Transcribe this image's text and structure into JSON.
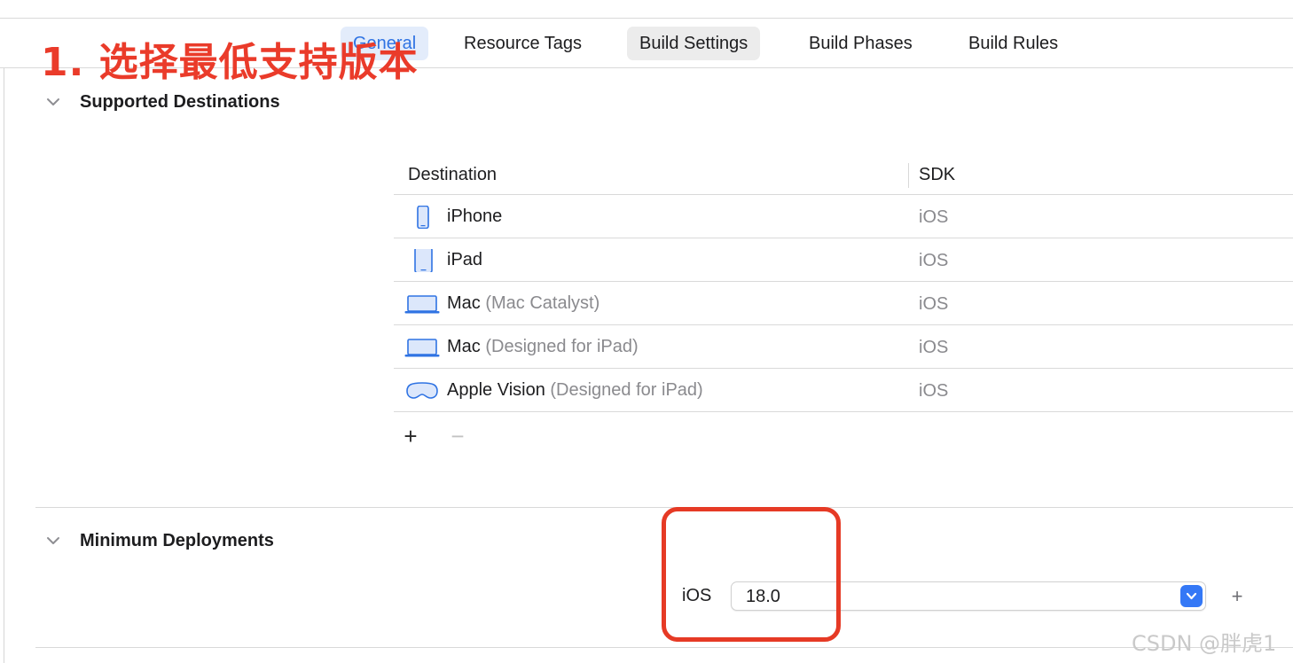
{
  "tabs": [
    {
      "label": "General"
    },
    {
      "label": "Resource Tags"
    },
    {
      "label": "Build Settings"
    },
    {
      "label": "Build Phases"
    },
    {
      "label": "Build Rules"
    }
  ],
  "annotation": {
    "title": "1. 选择最低支持版本",
    "color": "#ea3b2a"
  },
  "supported_destinations": {
    "title": "Supported Destinations",
    "columns": {
      "destination": "Destination",
      "sdk": "SDK"
    },
    "rows": [
      {
        "icon": "iphone-icon",
        "name": "iPhone",
        "detail": "",
        "sdk": "iOS"
      },
      {
        "icon": "ipad-icon",
        "name": "iPad",
        "detail": "",
        "sdk": "iOS"
      },
      {
        "icon": "laptop-icon",
        "name": "Mac",
        "detail": "(Mac Catalyst)",
        "sdk": "iOS"
      },
      {
        "icon": "laptop-icon",
        "name": "Mac",
        "detail": "(Designed for iPad)",
        "sdk": "iOS"
      },
      {
        "icon": "vision-headset-icon",
        "name": "Apple Vision",
        "detail": "(Designed for iPad)",
        "sdk": "iOS"
      }
    ],
    "add_label": "+",
    "remove_label": "−"
  },
  "minimum_deployments": {
    "title": "Minimum Deployments",
    "platform_label": "iOS",
    "version_value": "18.0",
    "add_label": "+"
  },
  "watermark": "CSDN @胖虎1",
  "colors": {
    "accent": "#3478f6",
    "icon_blue": "#2f73e3",
    "annotation_red": "#e63a25"
  }
}
